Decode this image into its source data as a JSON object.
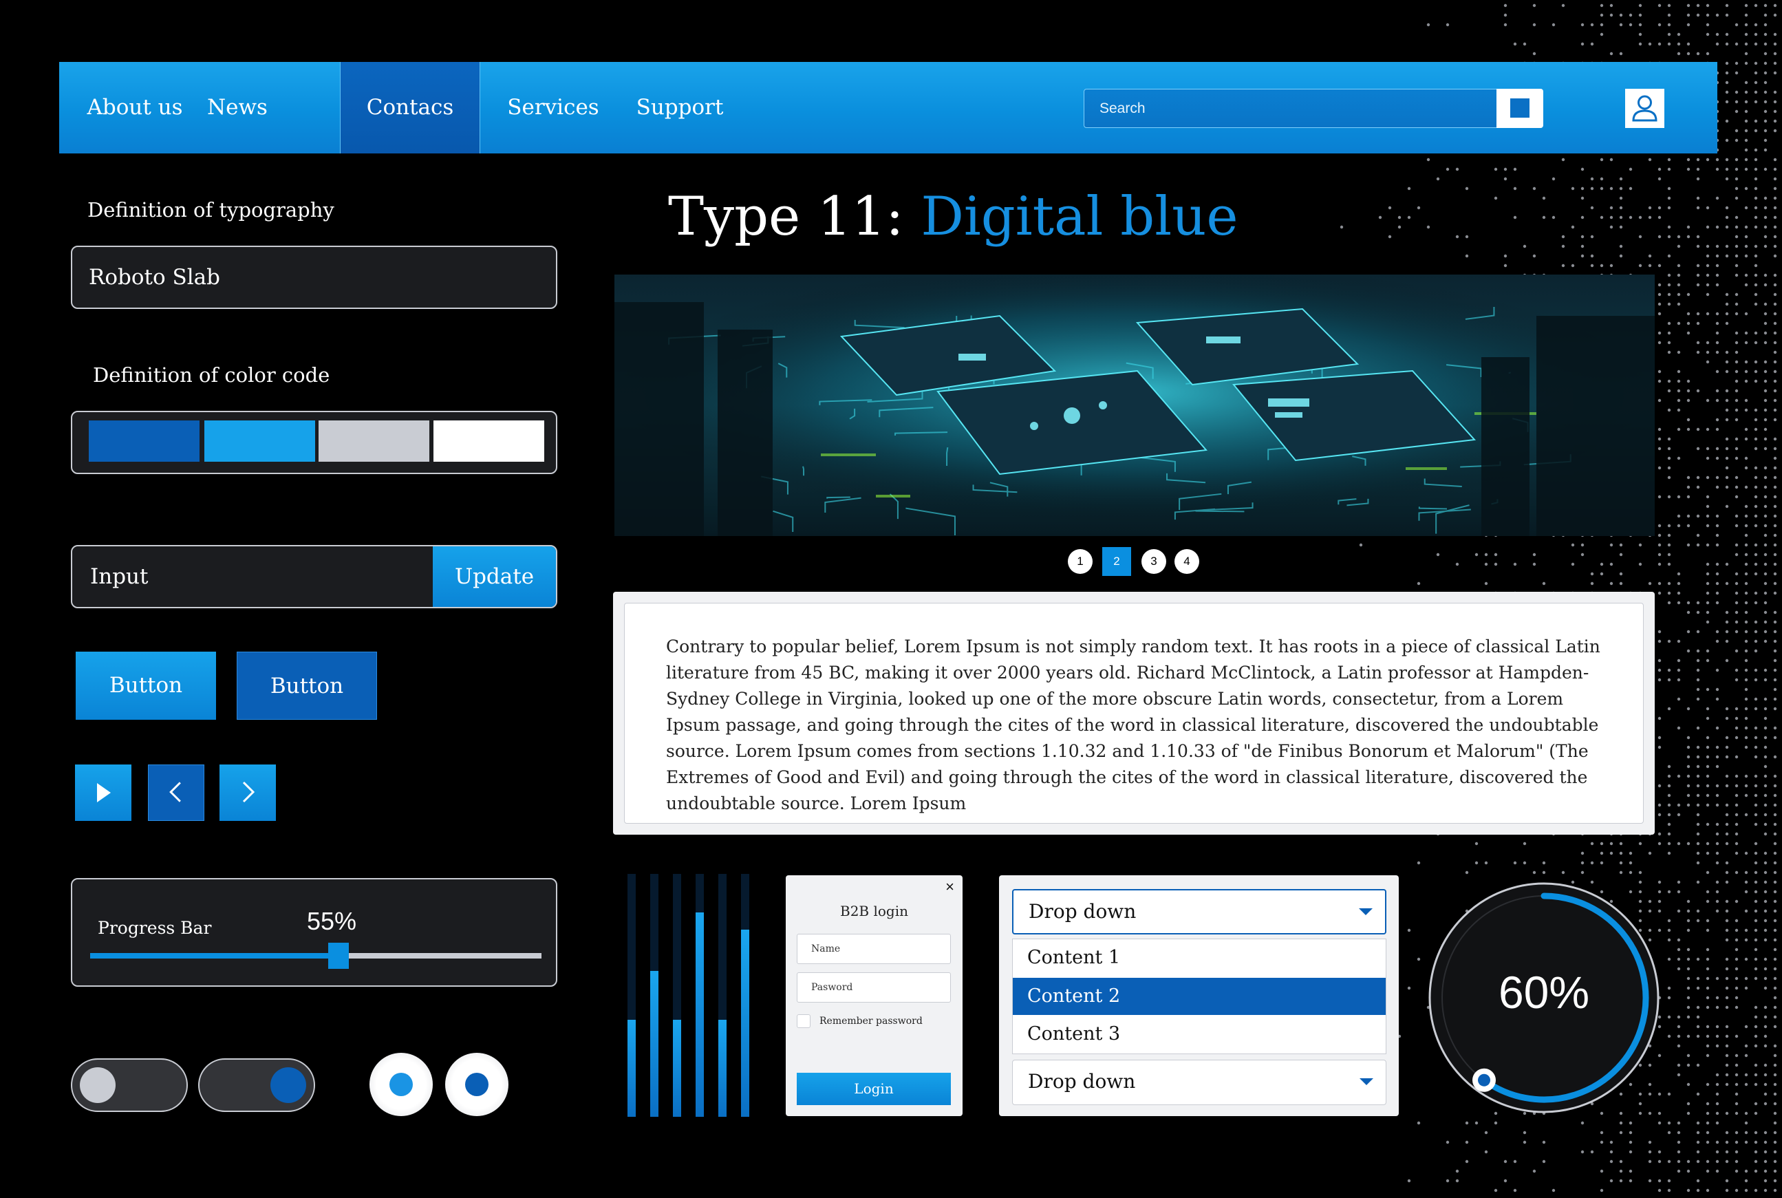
{
  "nav": {
    "items": [
      {
        "label": "About us"
      },
      {
        "label": "News"
      },
      {
        "label": "Contacs"
      },
      {
        "label": "Services"
      },
      {
        "label": "Support"
      }
    ],
    "active_index": 2,
    "search_placeholder": "Search"
  },
  "typography": {
    "label": "Definition of typography",
    "value": "Roboto Slab"
  },
  "color_code": {
    "label": "Definition of color code",
    "swatches": [
      "#0a5fb6",
      "#16a2ea",
      "#c9ccd3",
      "#ffffff"
    ]
  },
  "input_field": {
    "placeholder": "Input",
    "button_label": "Update"
  },
  "buttons": {
    "primary_label": "Button",
    "secondary_label": "Button"
  },
  "progress": {
    "label": "Progress Bar",
    "value_text": "55%",
    "value": 0.55
  },
  "headline": {
    "prefix": "Type 11: ",
    "highlight": "Digital blue"
  },
  "carousel": {
    "pages": [
      "1",
      "2",
      "3",
      "4"
    ],
    "active_page": 1
  },
  "article": {
    "text": "Contrary to popular belief, Lorem Ipsum is not simply random text. It has roots in a piece of classical Latin literature from 45 BC, making it over 2000 years old. Richard McClintock, a Latin professor at Hampden-Sydney College in Virginia, looked up one of the more obscure Latin words, consectetur, from a Lorem Ipsum passage, and going through the cites of the word in classical literature, discovered the undoubtable source. Lorem Ipsum comes from sections 1.10.32 and 1.10.33 of \"de Finibus Bonorum et Malorum\" (The Extremes of Good and Evil) and going through the cites of the word in classical literature, discovered the undoubtable source. Lorem Ipsum"
  },
  "equalizer": {
    "levels": [
      0.4,
      0.6,
      0.4,
      0.84,
      0.4,
      0.77
    ]
  },
  "login": {
    "title": "B2B login",
    "close": "×",
    "name_placeholder": "Name",
    "password_placeholder": "Pasword",
    "remember_label": "Remember password",
    "button_label": "Login"
  },
  "dropdown": {
    "selected_label": "Drop down",
    "options": [
      "Content 1",
      "Content 2",
      "Content 3"
    ],
    "highlighted_index": 1,
    "second_label": "Drop down"
  },
  "gauge": {
    "value_text": "60%",
    "value": 0.6
  },
  "colors": {
    "accent": "#16a2ea",
    "accent_dark": "#0a5fb6",
    "background": "#000000"
  }
}
